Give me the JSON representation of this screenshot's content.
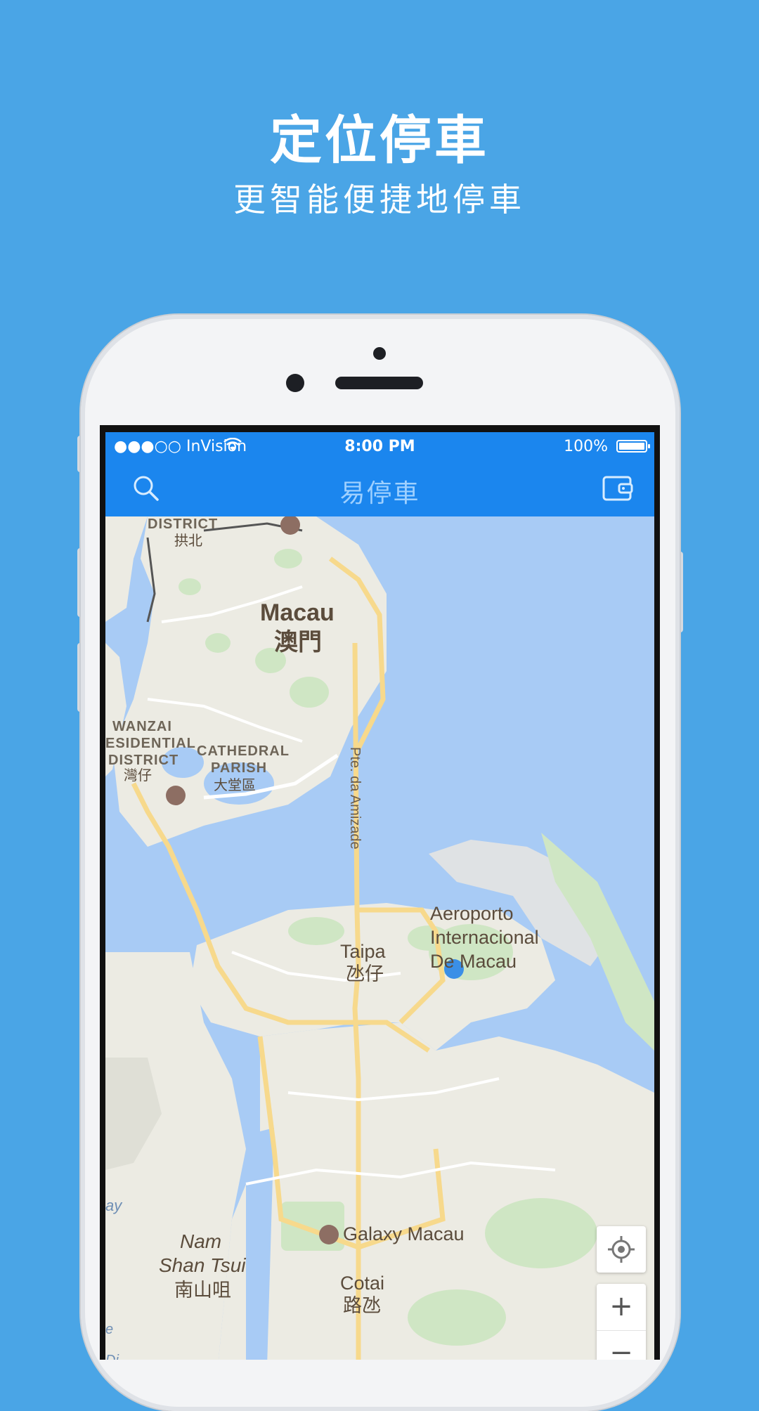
{
  "promo": {
    "title": "定位停車",
    "subtitle": "更智能便捷地停車"
  },
  "status_bar": {
    "carrier": "●●●○○ InVision",
    "time": "8:00 PM",
    "battery": "100%"
  },
  "nav": {
    "title": "易停車",
    "left_icon": "search-icon",
    "right_icon": "wallet-icon"
  },
  "map": {
    "labels": {
      "district_top": "DISTRICT",
      "district_top_cn": "拱北",
      "macau": "Macau",
      "macau_cn": "澳門",
      "wanzai_1": "WANZAI",
      "wanzai_2": "ESIDENTIAL",
      "wanzai_3": "DISTRICT",
      "wanzai_cn": "灣仔",
      "cathedral_1": "CATHEDRAL",
      "cathedral_2": "PARISH",
      "cathedral_cn": "大堂區",
      "bridge": "Pte. da Amizade",
      "airport_1": "Aeroporto",
      "airport_2": "Internacional",
      "airport_3": "De Macau",
      "taipa": "Taipa",
      "taipa_cn": "氹仔",
      "galaxy": "Galaxy Macau",
      "nam_1": "Nam",
      "nam_2": "Shan Tsui",
      "nam_cn": "南山咀",
      "cotai": "Cotai",
      "cotai_cn": "路氹",
      "edge_ay": "ay",
      "edge_e": "e",
      "edge_di": "Di"
    },
    "controls": {
      "locate_icon": "my-location-icon",
      "zoom_in": "+",
      "zoom_out": "−",
      "expand_icon": "chevron-double-up-icon",
      "pegman_icon": "pegman-icon",
      "gps_icon": "crosshair-icon"
    }
  },
  "colors": {
    "background": "#4aa5e6",
    "nav_bar": "#1b86ee",
    "water": "#a8cbf5",
    "land": "#ecebe3",
    "park": "#cfe6c4",
    "road": "#f7d98c"
  }
}
